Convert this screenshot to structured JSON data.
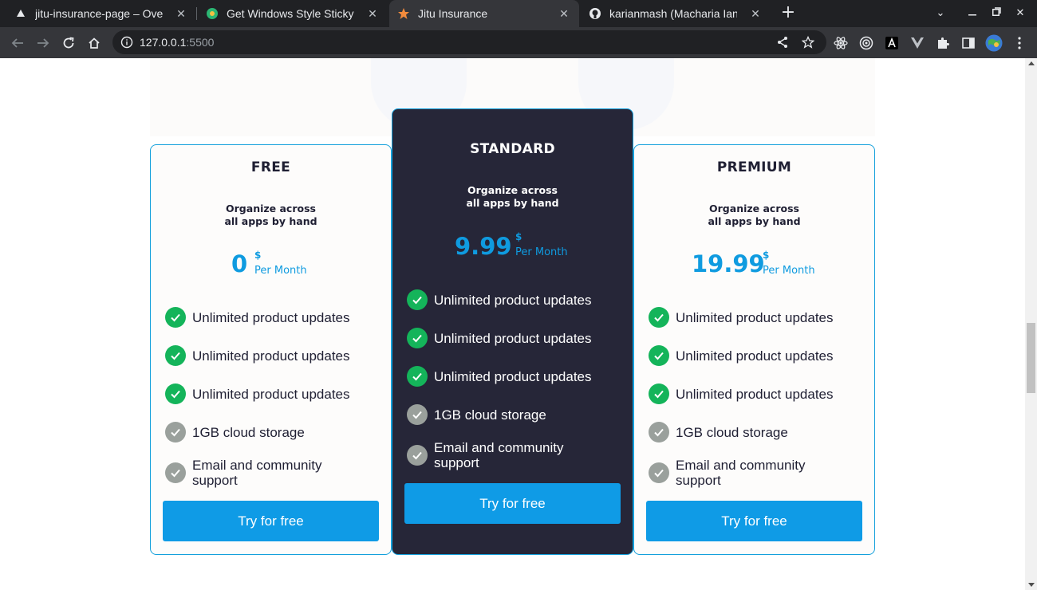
{
  "browser": {
    "tabs": [
      {
        "title": "jitu-insurance-page – Overview",
        "icon": "vercel-triangle-icon",
        "active": false
      },
      {
        "title": "Get Windows Style Sticky Notes",
        "icon": "extension-puzzle-icon",
        "active": false
      },
      {
        "title": "Jitu Insurance",
        "icon": "star-icon",
        "active": true
      },
      {
        "title": "karianmash (Macharia Ian)",
        "icon": "github-icon",
        "active": false
      }
    ],
    "url_host": "127.0.0.1",
    "url_port": ":5500"
  },
  "pricing": {
    "plans": [
      {
        "name": "FREE",
        "desc_line1": "Organize across",
        "desc_line2": "all apps by hand",
        "price": "0",
        "currency": "$",
        "period": "Per Month",
        "features": [
          {
            "label": "Unlimited product updates",
            "included": true
          },
          {
            "label": "Unlimited product updates",
            "included": true
          },
          {
            "label": "Unlimited product updates",
            "included": true
          },
          {
            "label": "1GB cloud storage",
            "included": false
          },
          {
            "label": "Email and community support",
            "included": false
          }
        ],
        "cta": "Try for free"
      },
      {
        "name": "STANDARD",
        "desc_line1": "Organize across",
        "desc_line2": "all apps by hand",
        "price": "9.99",
        "currency": "$",
        "period": "Per Month",
        "features": [
          {
            "label": "Unlimited product updates",
            "included": true
          },
          {
            "label": "Unlimited product updates",
            "included": true
          },
          {
            "label": "Unlimited product updates",
            "included": true
          },
          {
            "label": "1GB cloud storage",
            "included": false
          },
          {
            "label": "Email and community support",
            "included": false
          }
        ],
        "cta": "Try for free"
      },
      {
        "name": "PREMIUM",
        "desc_line1": "Organize across",
        "desc_line2": "all apps by hand",
        "price": "19.99",
        "currency": "$",
        "period": "Per Month",
        "features": [
          {
            "label": "Unlimited product updates",
            "included": true
          },
          {
            "label": "Unlimited product updates",
            "included": true
          },
          {
            "label": "Unlimited product updates",
            "included": true
          },
          {
            "label": "1GB cloud storage",
            "included": false
          },
          {
            "label": "Email and community support",
            "included": false
          }
        ],
        "cta": "Try for free"
      }
    ]
  },
  "colors": {
    "accent": "#0f9be6",
    "check_on": "#14b45a",
    "check_off": "#9aa09c",
    "dark_card": "#262638"
  }
}
